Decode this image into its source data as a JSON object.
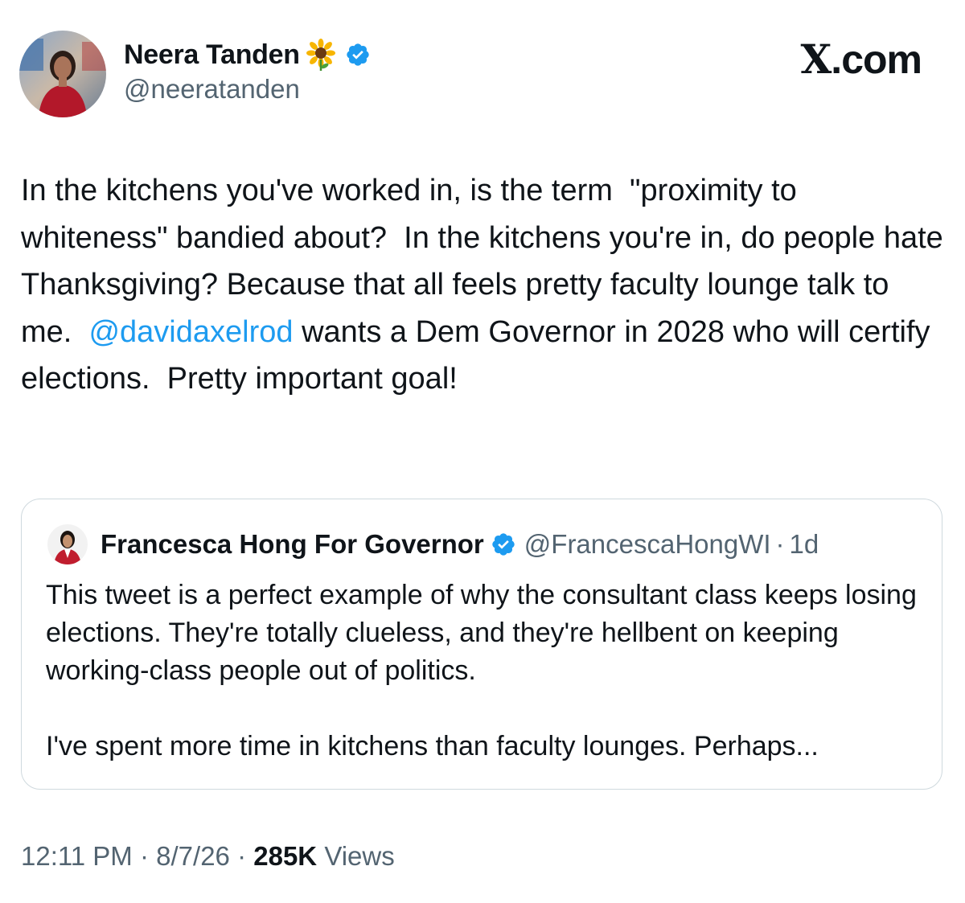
{
  "brand": {
    "logo_text": "X",
    "domain_text": ".com"
  },
  "author": {
    "display_name": "Neera Tanden",
    "name_emoji": "sunflower-icon",
    "verified": true,
    "handle": "@neeratanden"
  },
  "tweet": {
    "text_parts": [
      "In the kitchens you've worked in, is the term  \"proximity to whiteness\" bandied about?  In the kitchens you're in, do people hate Thanksgiving? Because that all feels pretty faculty lounge talk to me.  ",
      " wants a Dem Governor in 2028 who will certify elections.  Pretty important goal!"
    ],
    "mention": "@davidaxelrod"
  },
  "quoted_tweet": {
    "display_name": "Francesca Hong For Governor",
    "verified": true,
    "handle": "@FrancescaHongWI",
    "separator": "·",
    "age": "1d",
    "paragraphs": [
      "This tweet is a perfect example of why the consultant class keeps losing elections. They're totally clueless, and they're hellbent on keeping working-class people out of politics.",
      "I've spent more time in kitchens than faculty lounges. Perhaps..."
    ]
  },
  "footer": {
    "time": "12:11 PM",
    "separator": "·",
    "date": "8/7/26",
    "views_count": "285K",
    "views_label": "Views"
  },
  "colors": {
    "text": "#0f1419",
    "secondary": "#536471",
    "accent": "#1d9bf0",
    "border": "#cfd9de"
  }
}
